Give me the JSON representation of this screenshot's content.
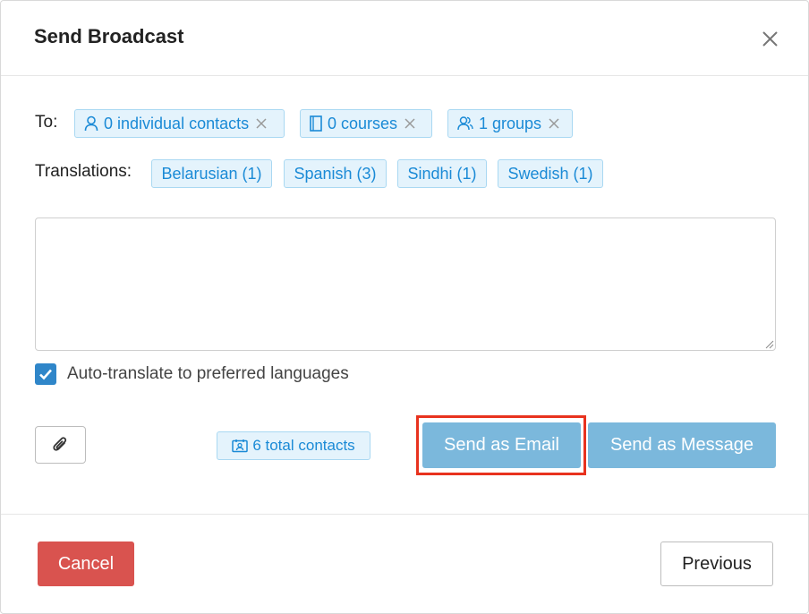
{
  "dialog": {
    "title": "Send Broadcast",
    "close_icon": "close-icon"
  },
  "recipients": {
    "label": "To:",
    "chips": [
      {
        "icon": "user-icon",
        "text": "0 individual contacts"
      },
      {
        "icon": "book-icon",
        "text": "0 courses"
      },
      {
        "icon": "users-icon",
        "text": "1 groups"
      }
    ]
  },
  "translations": {
    "label": "Translations:",
    "chips": [
      "Belarusian (1)",
      "Spanish (3)",
      "Sindhi (1)",
      "Swedish (1)"
    ]
  },
  "message": {
    "value": "",
    "placeholder": ""
  },
  "auto_translate": {
    "checked": true,
    "label": "Auto-translate to preferred languages"
  },
  "attach": {
    "icon": "paperclip-icon"
  },
  "total_contacts": {
    "icon": "contact-card-icon",
    "text": "6 total contacts"
  },
  "actions": {
    "send_email": "Send as Email",
    "send_message": "Send as Message"
  },
  "footer": {
    "cancel": "Cancel",
    "previous": "Previous"
  },
  "colors": {
    "chip_text": "#1a8ad6",
    "chip_bg": "#e4f3fc",
    "primary_button": "#7bb8dc",
    "cancel_button": "#d9534f",
    "highlight_border": "#e8321e",
    "checkbox": "#2f86c9"
  }
}
